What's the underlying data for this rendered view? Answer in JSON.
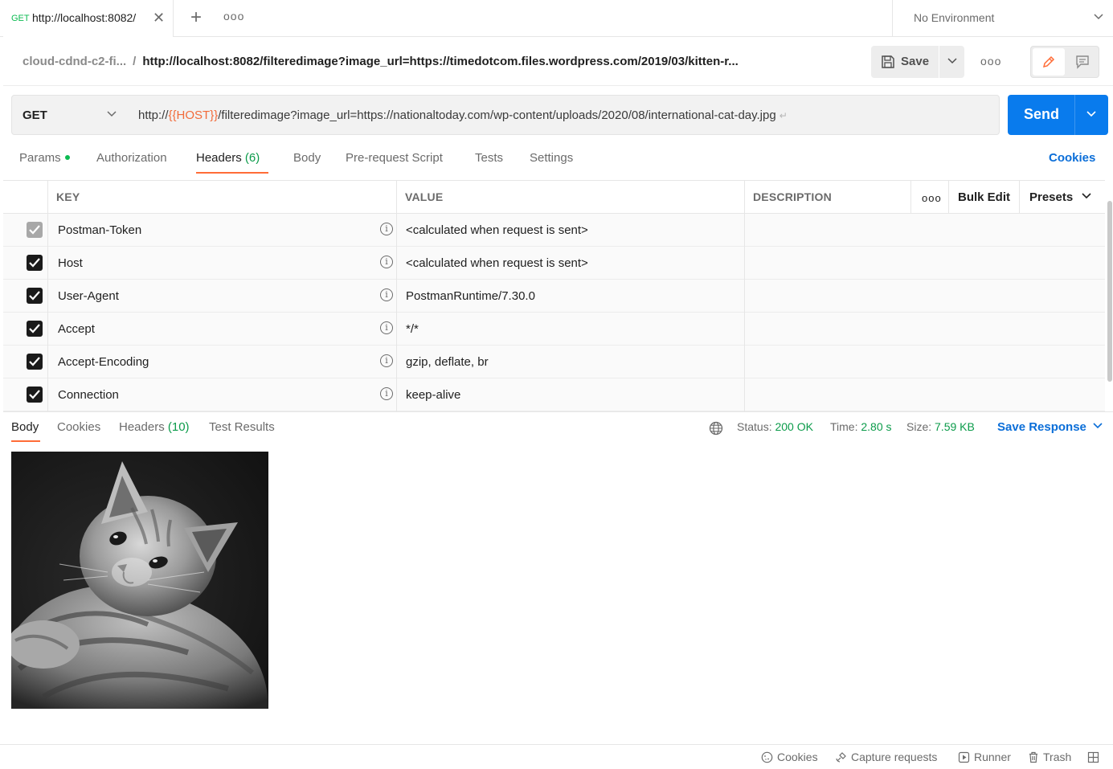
{
  "tab": {
    "method": "GET",
    "title": "http://localhost:8082/",
    "close_icon": "close-icon"
  },
  "environment": {
    "label": "No Environment"
  },
  "breadcrumb": {
    "parent": "cloud-cdnd-c2-fi...",
    "separator": "/",
    "current": "http://localhost:8082/filteredimage?image_url=https://timedotcom.files.wordpress.com/2019/03/kitten-r..."
  },
  "toolbar": {
    "save_label": "Save"
  },
  "request": {
    "method": "GET",
    "url_prefix": "http://",
    "url_variable": "{{HOST}}",
    "url_suffix": "/filteredimage?image_url=https://nationaltoday.com/wp-content/uploads/2020/08/international-cat-day.jpg",
    "send_label": "Send"
  },
  "request_tabs": [
    {
      "label": "Params"
    },
    {
      "label": "Authorization"
    },
    {
      "label": "Headers",
      "count": "(6)"
    },
    {
      "label": "Body"
    },
    {
      "label": "Pre-request Script"
    },
    {
      "label": "Tests"
    },
    {
      "label": "Settings"
    }
  ],
  "cookies_link": "Cookies",
  "headers_table": {
    "columns": {
      "key": "KEY",
      "value": "VALUE",
      "description": "DESCRIPTION"
    },
    "bulk_edit": "Bulk Edit",
    "presets": "Presets",
    "rows": [
      {
        "key": "Postman-Token",
        "value": "<calculated when request is sent>",
        "checked": true,
        "disabled": true
      },
      {
        "key": "Host",
        "value": "<calculated when request is sent>",
        "checked": true
      },
      {
        "key": "User-Agent",
        "value": "PostmanRuntime/7.30.0",
        "checked": true
      },
      {
        "key": "Accept",
        "value": "*/*",
        "checked": true
      },
      {
        "key": "Accept-Encoding",
        "value": "gzip, deflate, br",
        "checked": true
      },
      {
        "key": "Connection",
        "value": "keep-alive",
        "checked": true
      }
    ]
  },
  "response_tabs": [
    {
      "label": "Body"
    },
    {
      "label": "Cookies"
    },
    {
      "label": "Headers",
      "count": "(10)"
    },
    {
      "label": "Test Results"
    }
  ],
  "response_status": {
    "status_label": "Status:",
    "status_value": "200 OK",
    "time_label": "Time:",
    "time_value": "2.80 s",
    "size_label": "Size:",
    "size_value": "7.59 KB"
  },
  "save_response": "Save Response",
  "footer": {
    "cookies": "Cookies",
    "capture": "Capture requests",
    "runner": "Runner",
    "trash": "Trash"
  },
  "colors": {
    "accent_orange": "#ff6c37",
    "send_blue": "#097bed",
    "link_blue": "#0b6ed8",
    "success_green": "#0b9b4a"
  }
}
